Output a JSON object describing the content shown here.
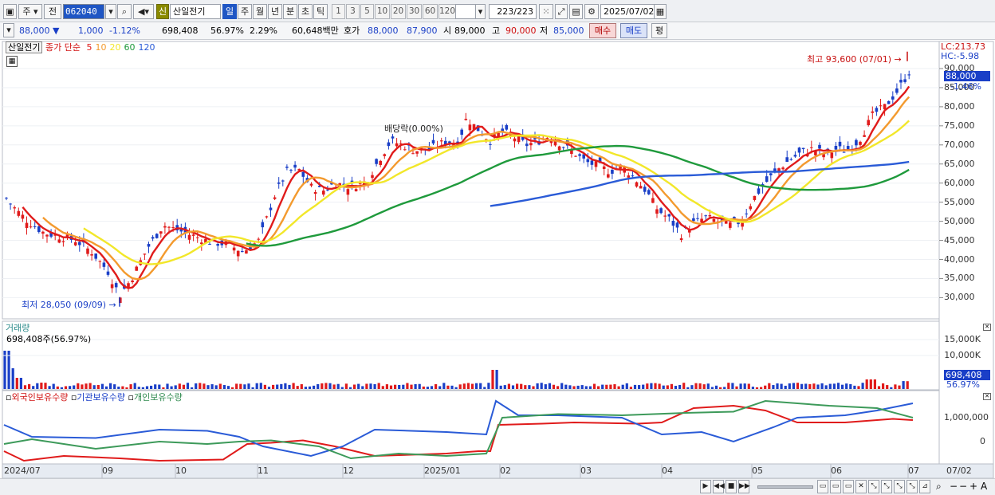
{
  "toolbar": {
    "period_select": "주",
    "prev_label": "전",
    "stock_code": "062040",
    "credit_badge": "신",
    "stock_name": "산일전기",
    "tabs": [
      "일",
      "주",
      "월",
      "년",
      "분",
      "초",
      "틱"
    ],
    "active_tab": "일",
    "intervals": [
      "1",
      "3",
      "5",
      "10",
      "20",
      "30",
      "60",
      "120"
    ],
    "count": "223",
    "total": "/223",
    "date": "2025/07/02"
  },
  "info": {
    "price": "88,000",
    "change": "1,000",
    "change_pct": "-1.12%",
    "volume": "698,408",
    "vol_ratio": "56.97%",
    "turnover": "2.29%",
    "amount": "60,648백만",
    "hoga_label": "호가",
    "ask": "88,000",
    "bid": "87,900",
    "open_label": "시",
    "open": "89,000",
    "high_label": "고",
    "high": "90,000",
    "low_label": "저",
    "low": "85,000",
    "buy_label": "매수",
    "sell_label": "매도",
    "flat_label": "평"
  },
  "price_panel": {
    "stock_tag": "산일전기",
    "ma_title": "종가 단순",
    "ma_periods": [
      "5",
      "10",
      "20",
      "60",
      "120"
    ],
    "ma_colors": [
      "#e01b1b",
      "#f39a2e",
      "#f2e72a",
      "#1f9a3c",
      "#2a5bd7"
    ],
    "high_note": "최고 93,600 (07/01)",
    "low_note": "최저 28,050 (09/09)",
    "dividend_note": "배당락(0.00%)",
    "lc": "LC:213.73",
    "hc": "HC:-5.98",
    "current_tag": "88,000",
    "current_pct": "-1.46%",
    "y_ticks": [
      "90,000",
      "85,000",
      "80,000",
      "75,000",
      "70,000",
      "65,000",
      "60,000",
      "55,000",
      "50,000",
      "45,000",
      "40,000",
      "35,000",
      "30,000"
    ]
  },
  "volume_panel": {
    "title": "거래량",
    "value_note": "698,408주(56.97%)",
    "y_ticks": [
      "15,000K",
      "10,000K"
    ],
    "current_tag": "698,408",
    "current_pct": "56.97%"
  },
  "holdings_panel": {
    "legend": [
      "외국인보유수량",
      "기관보유수량",
      "개인보유수량"
    ],
    "colors": [
      "#e01b1b",
      "#2a5bd7",
      "#3d9a5a"
    ],
    "y_ticks": [
      "1,000,000",
      "0"
    ]
  },
  "x_axis": [
    "2024/07",
    "09",
    "10",
    "11",
    "12",
    "2025/01",
    "02",
    "03",
    "04",
    "05",
    "06",
    "07"
  ],
  "x_axis_right": "07/02"
}
